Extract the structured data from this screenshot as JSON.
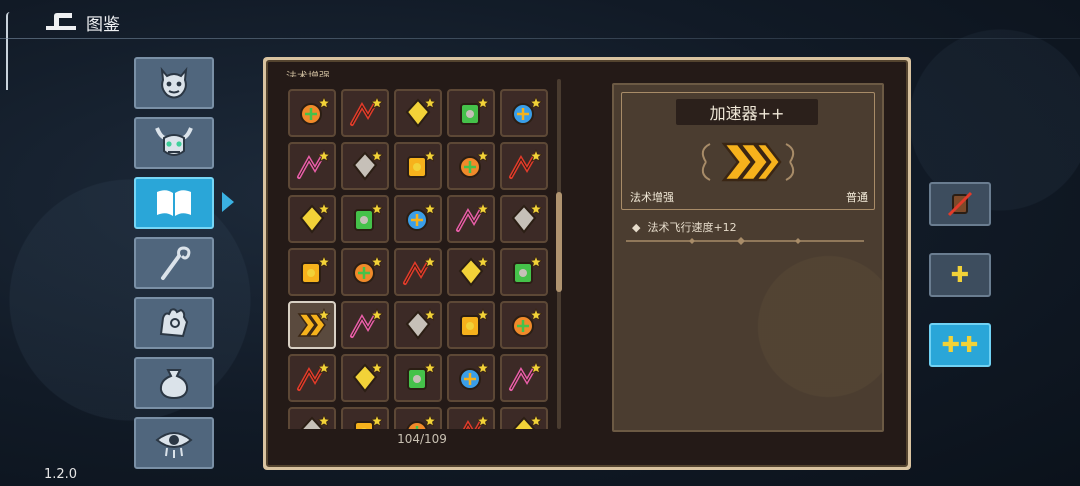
{
  "header": {
    "title": "图鉴",
    "back_icon": "back-arrow-icon"
  },
  "version": "1.2.0",
  "sidebar": {
    "categories": [
      {
        "id": "monsters",
        "icon": "demon-face-icon",
        "active": false
      },
      {
        "id": "bosses",
        "icon": "horned-skull-icon",
        "active": false
      },
      {
        "id": "spellbook",
        "icon": "open-book-icon",
        "active": true
      },
      {
        "id": "staffs",
        "icon": "staff-icon",
        "active": false
      },
      {
        "id": "relics",
        "icon": "hand-eye-icon",
        "active": false
      },
      {
        "id": "items",
        "icon": "pouch-icon",
        "active": false
      },
      {
        "id": "curses",
        "icon": "eye-icon",
        "active": false
      }
    ]
  },
  "grid": {
    "section_label": "法术增强",
    "count": "104/109",
    "scroll_fraction": 0.45,
    "selected_index": 20,
    "items": [
      {
        "icon": "triple-arrow-orange-icon"
      },
      {
        "icon": "triple-slash-red-icon"
      },
      {
        "icon": "flame-burst-icon"
      },
      {
        "icon": "gold-cloud-icon"
      },
      {
        "icon": "green-gem-icon"
      },
      {
        "icon": "orbit-spark-icon"
      },
      {
        "icon": "lightning-zigzag-icon"
      },
      {
        "icon": "pause-orb-icon"
      },
      {
        "icon": "crescent-swirl-icon"
      },
      {
        "icon": "mouse-icon"
      },
      {
        "icon": "crosshair-icon"
      },
      {
        "icon": "zigzag-arrow-icon"
      },
      {
        "icon": "triple-split-icon"
      },
      {
        "icon": "blue-crystal-icon"
      },
      {
        "icon": "white-cloud-icon"
      },
      {
        "icon": "bolt-split-icon"
      },
      {
        "icon": "up-arrows-icon"
      },
      {
        "icon": "target-wheel-icon"
      },
      {
        "icon": "battery-card-icon"
      },
      {
        "icon": "grid-rune-icon"
      },
      {
        "icon": "accelerator-chevrons-icon"
      },
      {
        "icon": "sun-icon"
      },
      {
        "icon": "red-potion-icon"
      },
      {
        "icon": "pink-cube-icon"
      },
      {
        "icon": "worm-icon"
      },
      {
        "icon": "red-orb-icon"
      },
      {
        "icon": "red-serpent-icon"
      },
      {
        "icon": "red-sigil-icon"
      },
      {
        "icon": "orange-spiral-icon"
      },
      {
        "icon": "blue-vortex-icon"
      },
      {
        "icon": "blue-bars-icon"
      },
      {
        "icon": "red-claw-icon"
      },
      {
        "icon": "orange-flower-icon"
      },
      {
        "icon": "red-horns-icon"
      },
      {
        "icon": "gold-shield-icon"
      }
    ]
  },
  "detail": {
    "name": "加速器++",
    "icon": "accelerator-chevrons-icon",
    "type": "法术增强",
    "rarity": "普通",
    "stats": [
      "法术飞行速度+12"
    ]
  },
  "right_buttons": [
    {
      "id": "base",
      "icon": "crossed-card-icon",
      "active": false
    },
    {
      "id": "plus",
      "label": "✚",
      "active": false
    },
    {
      "id": "plus-plus",
      "label": "✚✚",
      "active": true
    }
  ],
  "colors": {
    "accent_blue": "#2aa6d8",
    "frame_tan": "#d9c3a0",
    "panel_dark": "#241a17",
    "gold": "#f2d238"
  }
}
